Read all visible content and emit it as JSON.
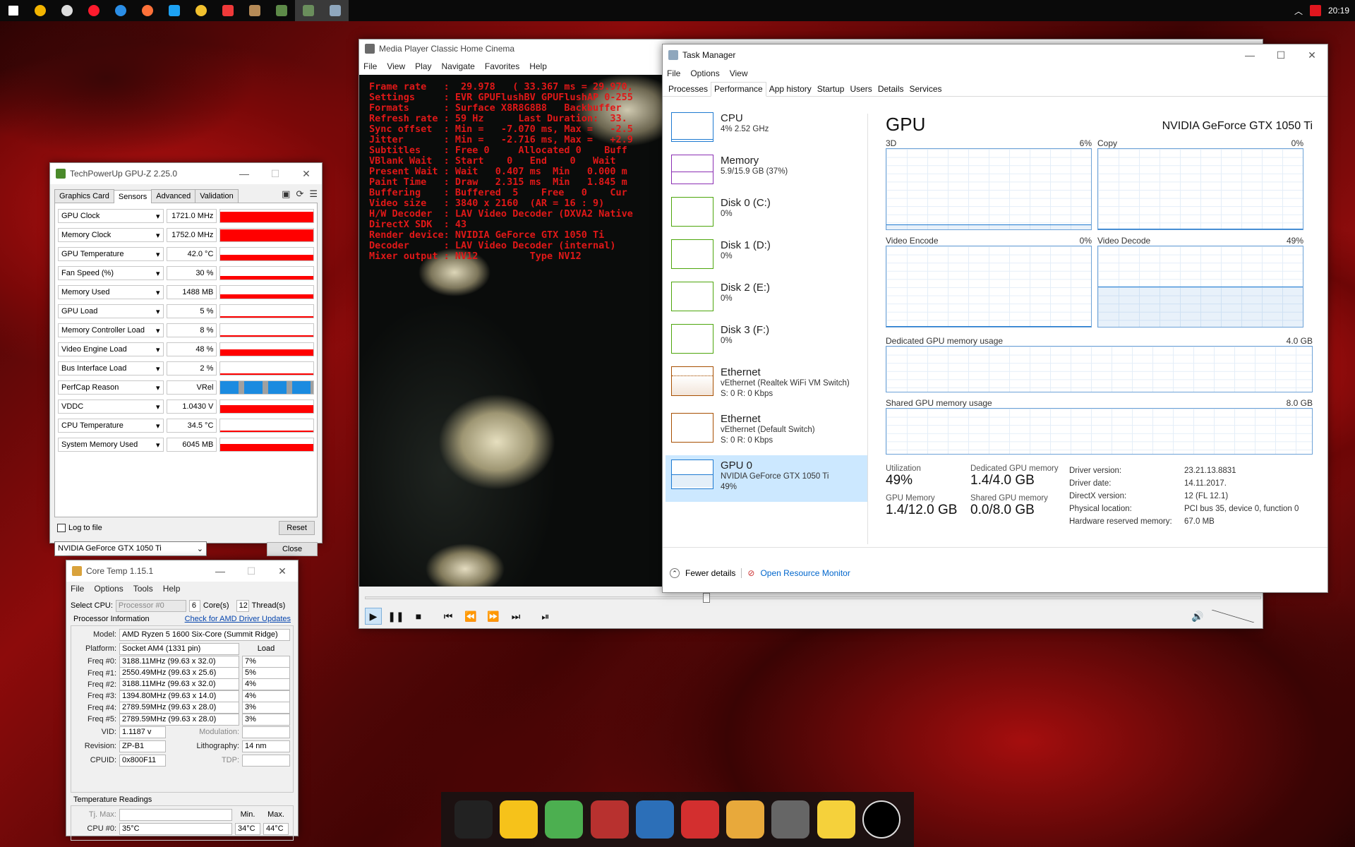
{
  "taskbar": {
    "icons": [
      "start-icon",
      "search-icon",
      "chrome-icon",
      "opera-icon",
      "edge-icon",
      "firefox-icon",
      "twitter-icon",
      "chrome-canary-icon",
      "vivaldi-icon",
      "app-icon",
      "app-icon",
      "media-player-icon",
      "task-manager-icon"
    ],
    "clock": "20:19"
  },
  "gpuz": {
    "title": "TechPowerUp GPU-Z 2.25.0",
    "tabs": [
      "Graphics Card",
      "Sensors",
      "Advanced",
      "Validation"
    ],
    "selected_tab": "Sensors",
    "sensors": [
      {
        "name": "GPU Clock",
        "value": "1721.0 MHz",
        "level": 0.85
      },
      {
        "name": "Memory Clock",
        "value": "1752.0 MHz",
        "level": 0.95
      },
      {
        "name": "GPU Temperature",
        "value": "42.0 °C",
        "level": 0.45
      },
      {
        "name": "Fan Speed (%)",
        "value": "30 %",
        "level": 0.3
      },
      {
        "name": "Memory Used",
        "value": "1488 MB",
        "level": 0.35
      },
      {
        "name": "GPU Load",
        "value": "5 %",
        "level": 0.05
      },
      {
        "name": "Memory Controller Load",
        "value": "8 %",
        "level": 0.08
      },
      {
        "name": "Video Engine Load",
        "value": "48 %",
        "level": 0.48
      },
      {
        "name": "Bus Interface Load",
        "value": "2 %",
        "level": 0.02
      },
      {
        "name": "PerfCap Reason",
        "value": "VRel",
        "level": 1.0
      },
      {
        "name": "VDDC",
        "value": "1.0430 V",
        "level": 0.6
      },
      {
        "name": "CPU Temperature",
        "value": "34.5 °C",
        "level": 0.1
      },
      {
        "name": "System Memory Used",
        "value": "6045 MB",
        "level": 0.55
      }
    ],
    "log_to_file": "Log to file",
    "reset": "Reset",
    "device": "NVIDIA GeForce GTX 1050 Ti",
    "close": "Close"
  },
  "coretemp": {
    "title": "Core Temp 1.15.1",
    "menu": [
      "File",
      "Options",
      "Tools",
      "Help"
    ],
    "select_cpu_label": "Select CPU:",
    "processor_select": "Processor #0",
    "cores_value": "6",
    "cores_label": "Core(s)",
    "threads_value": "12",
    "threads_label": "Thread(s)",
    "proc_info_label": "Processor Information",
    "driver_link": "Check for AMD Driver Updates",
    "model_label": "Model:",
    "model": "AMD Ryzen 5 1600 Six-Core (Summit Ridge)",
    "platform_label": "Platform:",
    "platform": "Socket AM4 (1331 pin)",
    "load_label": "Load",
    "freqs": [
      {
        "label": "Freq #0:",
        "value": "3188.11MHz (99.63 x 32.0)",
        "load": "7%"
      },
      {
        "label": "Freq #1:",
        "value": "2550.49MHz (99.63 x 25.6)",
        "load": "5%"
      },
      {
        "label": "Freq #2:",
        "value": "3188.11MHz (99.63 x 32.0)",
        "load": "4%"
      },
      {
        "label": "Freq #3:",
        "value": "1394.80MHz (99.63 x 14.0)",
        "load": "4%"
      },
      {
        "label": "Freq #4:",
        "value": "2789.59MHz (99.63 x 28.0)",
        "load": "3%"
      },
      {
        "label": "Freq #5:",
        "value": "2789.59MHz (99.63 x 28.0)",
        "load": "3%"
      }
    ],
    "vid_label": "VID:",
    "vid": "1.1187 v",
    "modulation_label": "Modulation:",
    "revision_label": "Revision:",
    "revision": "ZP-B1",
    "lithography_label": "Lithography:",
    "lithography": "14 nm",
    "cpuid_label": "CPUID:",
    "cpuid": "0x800F11",
    "tdp_label": "TDP:",
    "temp_label": "Temperature Readings",
    "tjmax_label": "Tj. Max:",
    "min_label": "Min.",
    "max_label": "Max.",
    "cpu0_label": "CPU #0:",
    "cpu0_temp": "35°C",
    "cpu0_min": "34°C",
    "cpu0_max": "44°C"
  },
  "mpc": {
    "title": "Media Player Classic Home Cinema",
    "menu": [
      "File",
      "View",
      "Play",
      "Navigate",
      "Favorites",
      "Help"
    ],
    "osd": [
      "Frame rate   :  29.978   ( 33.367 ms = 29.970,",
      "Settings     : EVR GPUFlushBV GPUFlushAP 0-255",
      "Formats      : Surface X8R8G8B8   Backbuffer",
      "Refresh rate : 59 Hz      Last Duration:  33.",
      "Sync offset  : Min =   -7.070 ms, Max =   -2.5",
      "Jitter       : Min =   -2.716 ms, Max =   +2.9",
      "Subtitles    : Free 0     Allocated 0    Buff",
      "VBlank Wait  : Start    0   End    0   Wait",
      "Present Wait : Wait   0.407 ms  Min   0.000 m",
      "Paint Time   : Draw   2.315 ms  Min   1.845 m",
      "Buffering    : Buffered  5    Free   0    Cur",
      "Video size   : 3840 x 2160  (AR = 16 : 9)",
      "H/W Decoder  : LAV Video Decoder (DXVA2 Native",
      "DirectX SDK  : 43",
      "Render device: NVIDIA GeForce GTX 1050 Ti",
      "Decoder      : LAV Video Decoder (internal)",
      "Mixer output : NV12         Type NV12"
    ]
  },
  "taskmgr": {
    "title": "Task Manager",
    "menu": [
      "File",
      "Options",
      "View"
    ],
    "tabs": [
      "Processes",
      "Performance",
      "App history",
      "Startup",
      "Users",
      "Details",
      "Services"
    ],
    "selected_tab": "Performance",
    "items": [
      {
        "name": "CPU",
        "l2": "4% 2.52 GHz",
        "l3": "",
        "color": "#1e7ad1"
      },
      {
        "name": "Memory",
        "l2": "5.9/15.9 GB (37%)",
        "l3": "",
        "color": "#8b2fb3"
      },
      {
        "name": "Disk 0 (C:)",
        "l2": "0%",
        "l3": "",
        "color": "#4da60c"
      },
      {
        "name": "Disk 1 (D:)",
        "l2": "0%",
        "l3": "",
        "color": "#4da60c"
      },
      {
        "name": "Disk 2 (E:)",
        "l2": "0%",
        "l3": "",
        "color": "#4da60c"
      },
      {
        "name": "Disk 3 (F:)",
        "l2": "0%",
        "l3": "",
        "color": "#4da60c"
      },
      {
        "name": "Ethernet",
        "l2": "vEthernet (Realtek WiFi VM Switch)",
        "l3": "S: 0 R: 0 Kbps",
        "color": "#a74f01"
      },
      {
        "name": "Ethernet",
        "l2": "vEthernet (Default Switch)",
        "l3": "S: 0 R: 0 Kbps",
        "color": "#a74f01"
      },
      {
        "name": "GPU 0",
        "l2": "NVIDIA GeForce GTX 1050 Ti",
        "l3": "49%",
        "color": "#1e7ad1"
      }
    ],
    "gpu_title": "GPU",
    "gpu_model": "NVIDIA GeForce GTX 1050 Ti",
    "graphs": [
      {
        "name": "3D",
        "pct": "6%"
      },
      {
        "name": "Copy",
        "pct": "0%"
      },
      {
        "name": "Video Encode",
        "pct": "0%"
      },
      {
        "name": "Video Decode",
        "pct": "49%"
      }
    ],
    "dedicated_label": "Dedicated GPU memory usage",
    "dedicated_max": "4.0 GB",
    "shared_label": "Shared GPU memory usage",
    "shared_max": "8.0 GB",
    "stats": {
      "utilization_label": "Utilization",
      "utilization": "49%",
      "dedicated_mem_label": "Dedicated GPU memory",
      "dedicated_mem": "1.4/4.0 GB",
      "gpu_mem_label": "GPU Memory",
      "gpu_mem": "1.4/12.0 GB",
      "shared_mem_label": "Shared GPU memory",
      "shared_mem": "0.0/8.0 GB"
    },
    "details": [
      {
        "k": "Driver version:",
        "v": "23.21.13.8831"
      },
      {
        "k": "Driver date:",
        "v": "14.11.2017."
      },
      {
        "k": "DirectX version:",
        "v": "12 (FL 12.1)"
      },
      {
        "k": "Physical location:",
        "v": "PCI bus 35, device 0, function 0"
      },
      {
        "k": "Hardware reserved memory:",
        "v": "67.0 MB"
      }
    ],
    "fewer_details": "Fewer details",
    "resource_monitor": "Open Resource Monitor"
  },
  "dock": [
    "gorilla-icon",
    "duck-icon",
    "leaf-icon",
    "ironman-icon",
    "clapperboard-icon",
    "cola-cup-icon",
    "pooh-icon",
    "einstein-icon",
    "lightbulb-icon",
    "terminal-icon"
  ],
  "colors": {
    "accent": "#1e7ad1",
    "gpuz_graph": "#ff0000",
    "osd": "#e01818",
    "perfcap_blue": "#1b8be0"
  }
}
